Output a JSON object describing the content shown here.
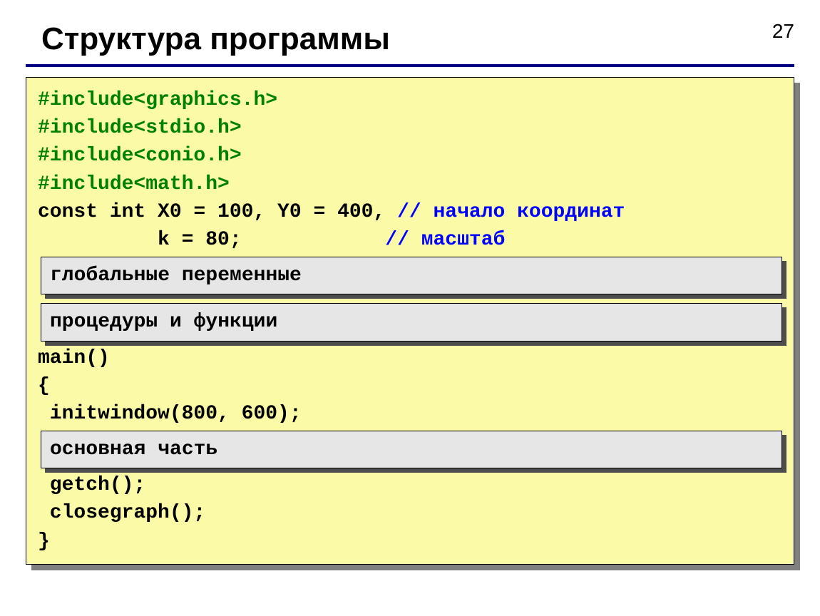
{
  "page_number": "27",
  "title": "Структура программы",
  "code": {
    "line1": "#include<graphics.h>",
    "line2": "#include<stdio.h>",
    "line3": "#include<conio.h>",
    "line4": "#include<math.h>",
    "line5a": "const int X0 = 100, Y0 = 400, ",
    "line5b": "// начало координат",
    "line6a": "          k = 80;            ",
    "line6b": "// масштаб",
    "line_main": "main()",
    "line_brace_open": "{",
    "line_init": " initwindow(800, 600);",
    "line_getch": " getch();",
    "line_close": " closegraph();",
    "line_brace_close": "}"
  },
  "boxes": {
    "globals": "глобальные переменные",
    "procs": "процедуры и функции",
    "main_part": "основная часть"
  }
}
